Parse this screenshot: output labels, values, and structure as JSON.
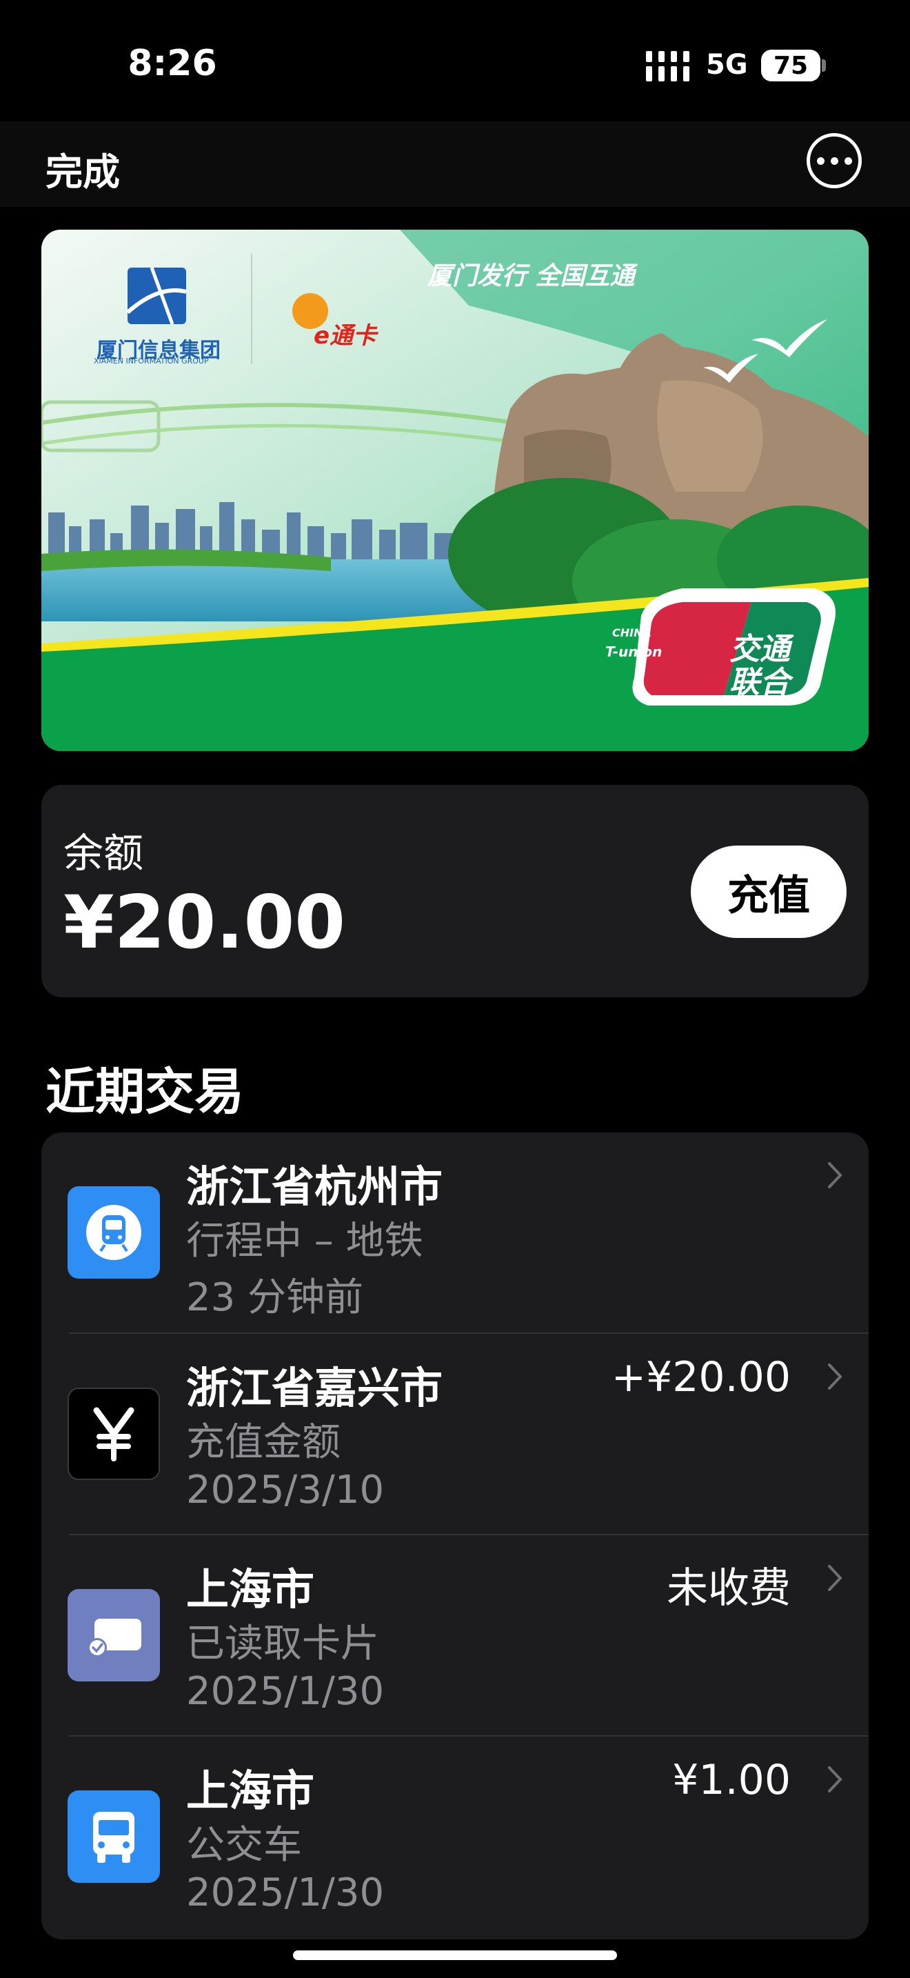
{
  "status_bar": {
    "time": "8:26",
    "network": "5G",
    "battery": "75"
  },
  "nav": {
    "done_label": "完成",
    "more_icon": "ellipsis-circle-icon"
  },
  "card": {
    "issuer": "厦门信息集团",
    "issuer_en": "XIAMEN INFORMATION GROUP",
    "brand": "e通卡",
    "slogan": "厦门发行 全国互通",
    "union_cn": "交通联合",
    "union_en_1": "CHINA",
    "union_en_2": "T-union"
  },
  "balance": {
    "label": "余额",
    "value": "¥20.00",
    "topup_label": "充值"
  },
  "recent": {
    "title": "近期交易"
  },
  "transactions": [
    {
      "city": "浙江省杭州市",
      "desc": "行程中 – 地铁",
      "time": "23 分钟前",
      "amount": "",
      "icon": "metro-icon",
      "icon_color": "#2f8ef4"
    },
    {
      "city": "浙江省嘉兴市",
      "desc": "充值金额",
      "time": "2025/3/10",
      "amount": "+¥20.00",
      "icon": "yen-icon",
      "icon_color": "#000000"
    },
    {
      "city": "上海市",
      "desc": "已读取卡片",
      "time": "2025/1/30",
      "amount": "未收费",
      "icon": "card-read-icon",
      "icon_color": "#6f7fc0"
    },
    {
      "city": "上海市",
      "desc": "公交车",
      "time": "2025/1/30",
      "amount": "¥1.00",
      "icon": "bus-icon",
      "icon_color": "#2f8ef4"
    }
  ]
}
